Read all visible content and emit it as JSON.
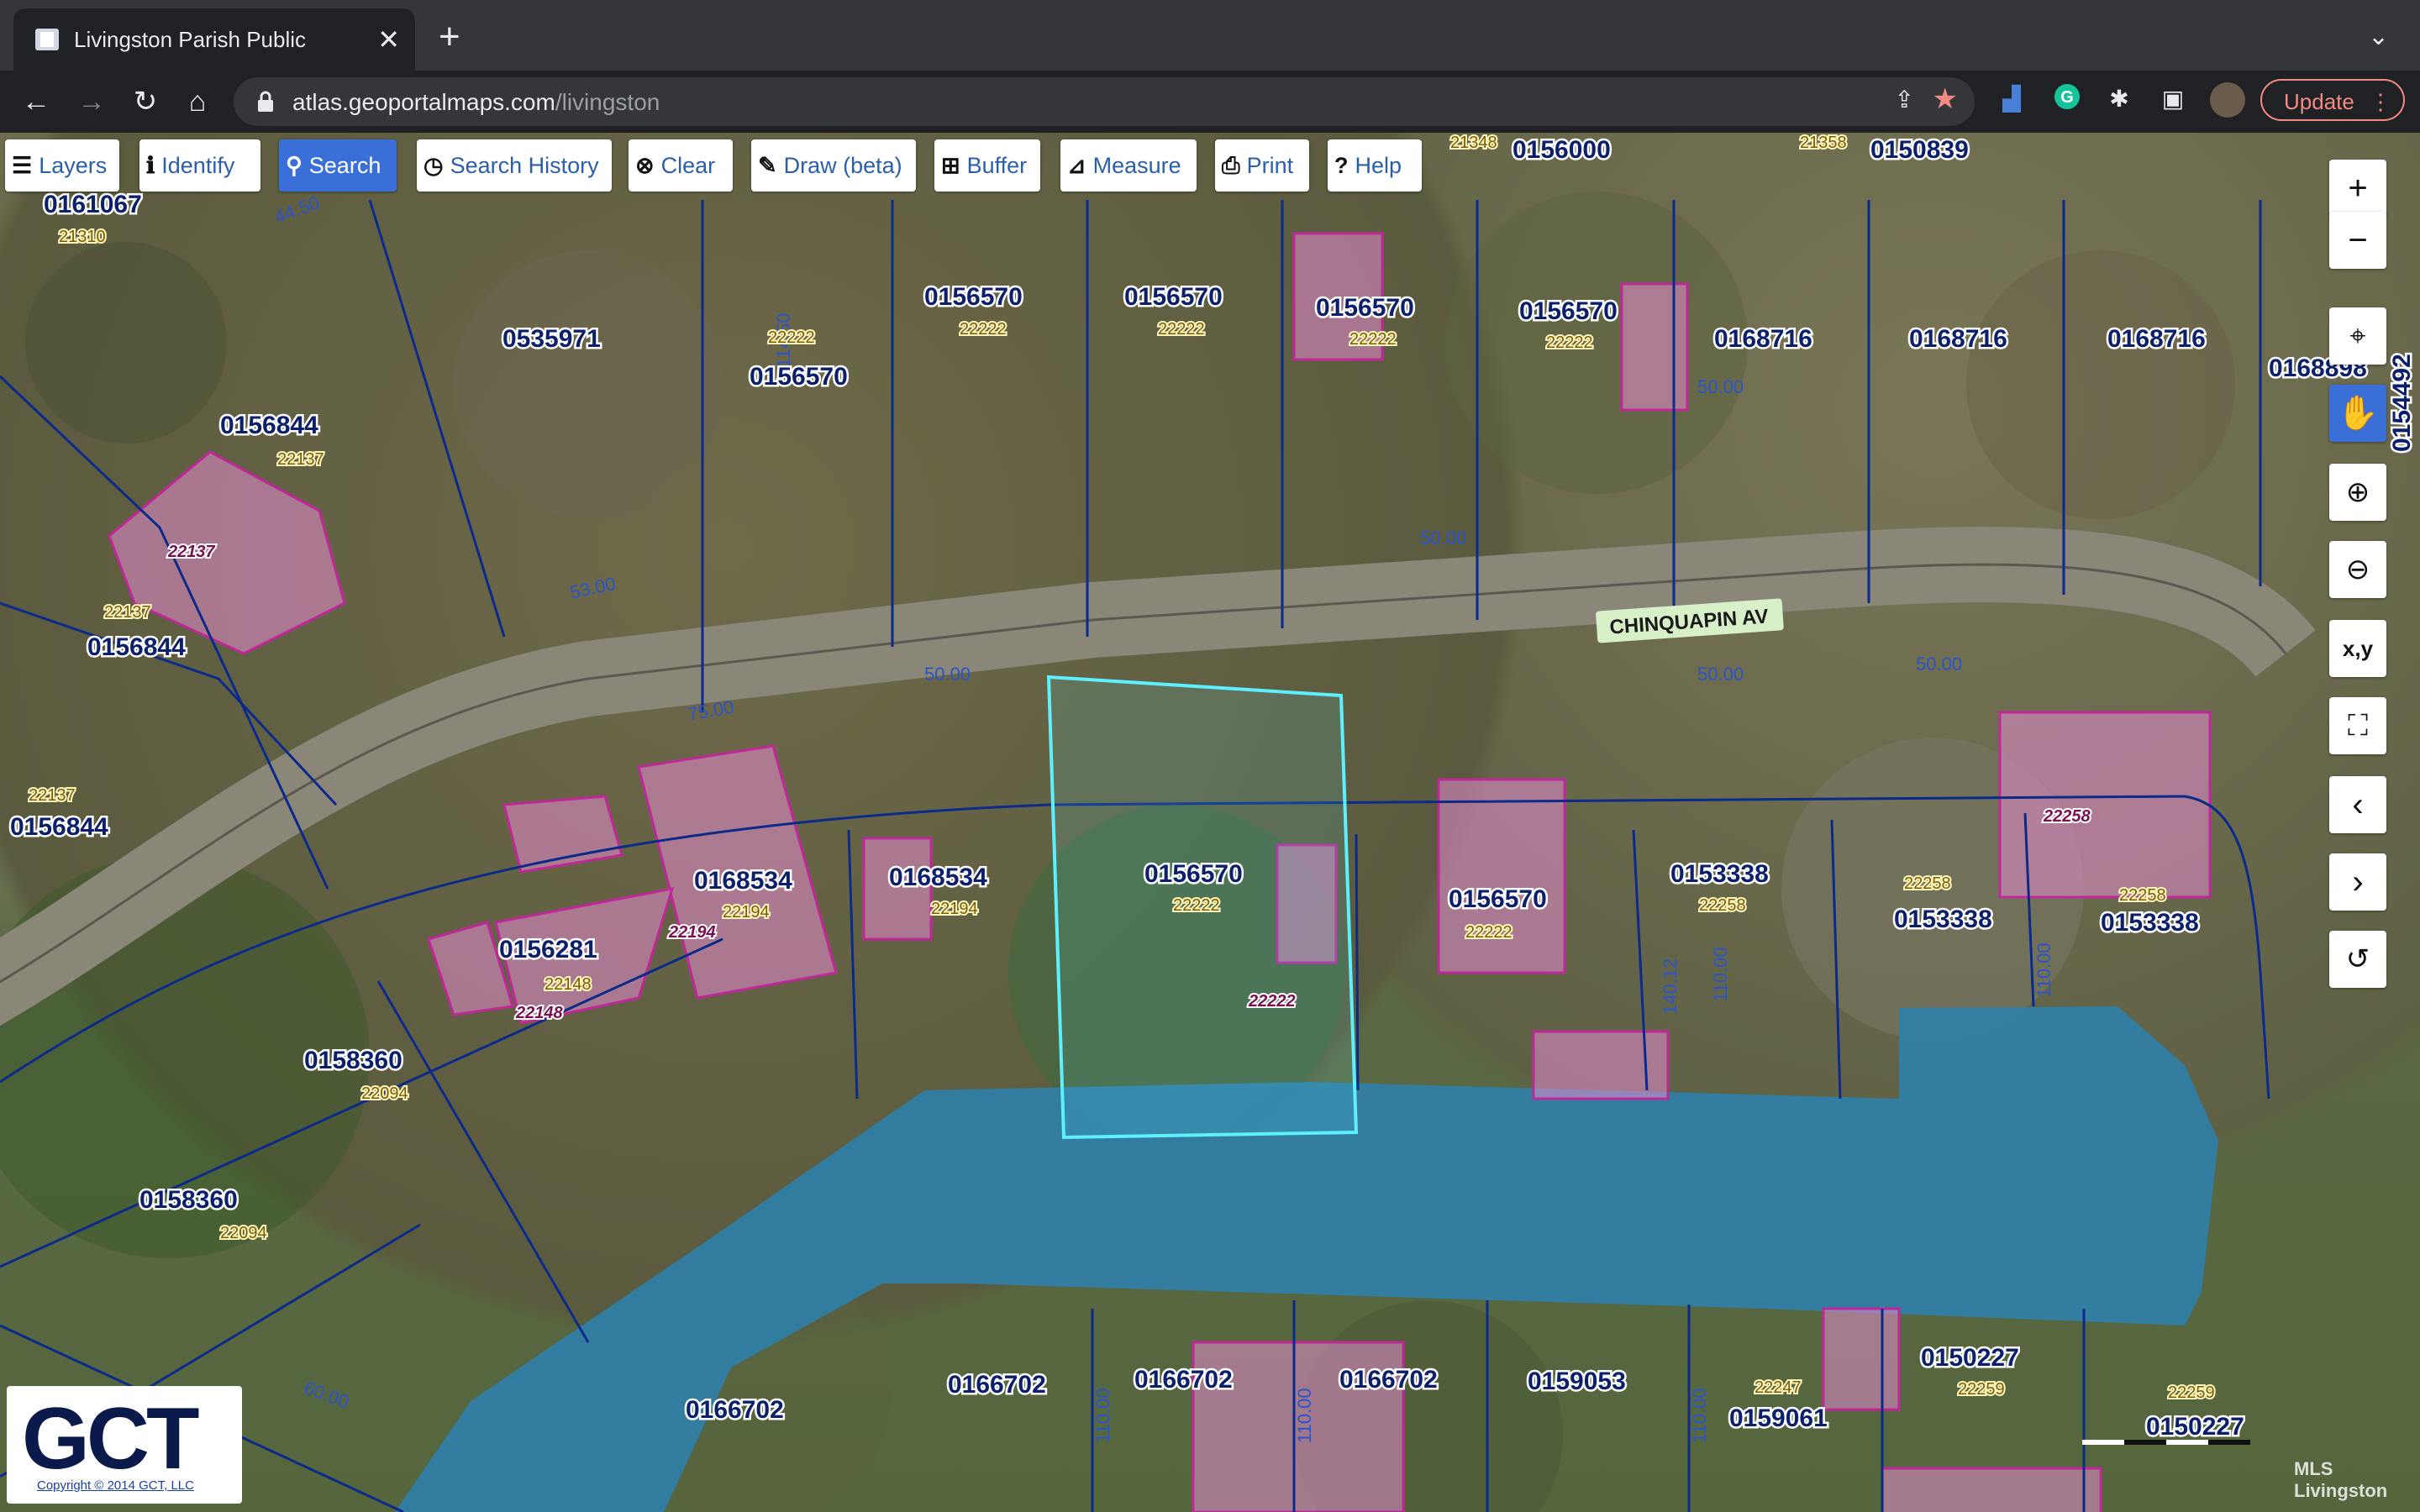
{
  "browser": {
    "tab_title": "Livingston Parish Public",
    "tab_close": "✕",
    "new_tab": "+",
    "tab_menu": "⌄",
    "url_host": "atlas.geoportalmaps.com",
    "url_path": "/livingston",
    "update_label": "Update",
    "update_menu": "⋮",
    "nav": {
      "back": "←",
      "forward": "→",
      "reload": "↻",
      "home": "⌂"
    }
  },
  "toolbar": {
    "layers": "Layers",
    "identify": "Identify",
    "search": "Search",
    "search_history": "Search History",
    "clear": "Clear",
    "draw": "Draw (beta)",
    "buffer": "Buffer",
    "measure": "Measure",
    "print": "Print",
    "help": "Help"
  },
  "map_controls": {
    "zoom_in": "+",
    "zoom_out": "−",
    "xy": "x,y"
  },
  "street": "CHINQUAPIN AV",
  "parcels": [
    {
      "id": "0161067",
      "addr": "21310"
    },
    {
      "id": "0535971",
      "addr": ""
    },
    {
      "id": "0156570",
      "addr": "22222"
    },
    {
      "id": "0156844",
      "addr": "22137"
    },
    {
      "id": "0168716",
      "addr": ""
    },
    {
      "id": "0156000",
      "addr": "21348"
    },
    {
      "id": "0150839",
      "addr": "21358"
    },
    {
      "id": "0168898",
      "addr": ""
    },
    {
      "id": "0154492",
      "addr": ""
    },
    {
      "id": "0168534",
      "addr": "22194"
    },
    {
      "id": "0156281",
      "addr": "22148"
    },
    {
      "id": "0153338",
      "addr": "22258"
    },
    {
      "id": "0158360",
      "addr": "22094"
    },
    {
      "id": "0166702",
      "addr": ""
    },
    {
      "id": "0159053",
      "addr": ""
    },
    {
      "id": "0159061",
      "addr": "22247"
    },
    {
      "id": "0150227",
      "addr": "22259"
    }
  ],
  "logo": {
    "text": "GCT",
    "copyright": "Copyright © 2014 GCT, LLC"
  },
  "watermark": "MLS Livingston",
  "colors": {
    "water": "#2f7fa8",
    "parcel_line": "#0b2a8a",
    "selected": "#5ef0ff",
    "structure": "#e58ccf",
    "active_button": "#3b6fd8"
  }
}
